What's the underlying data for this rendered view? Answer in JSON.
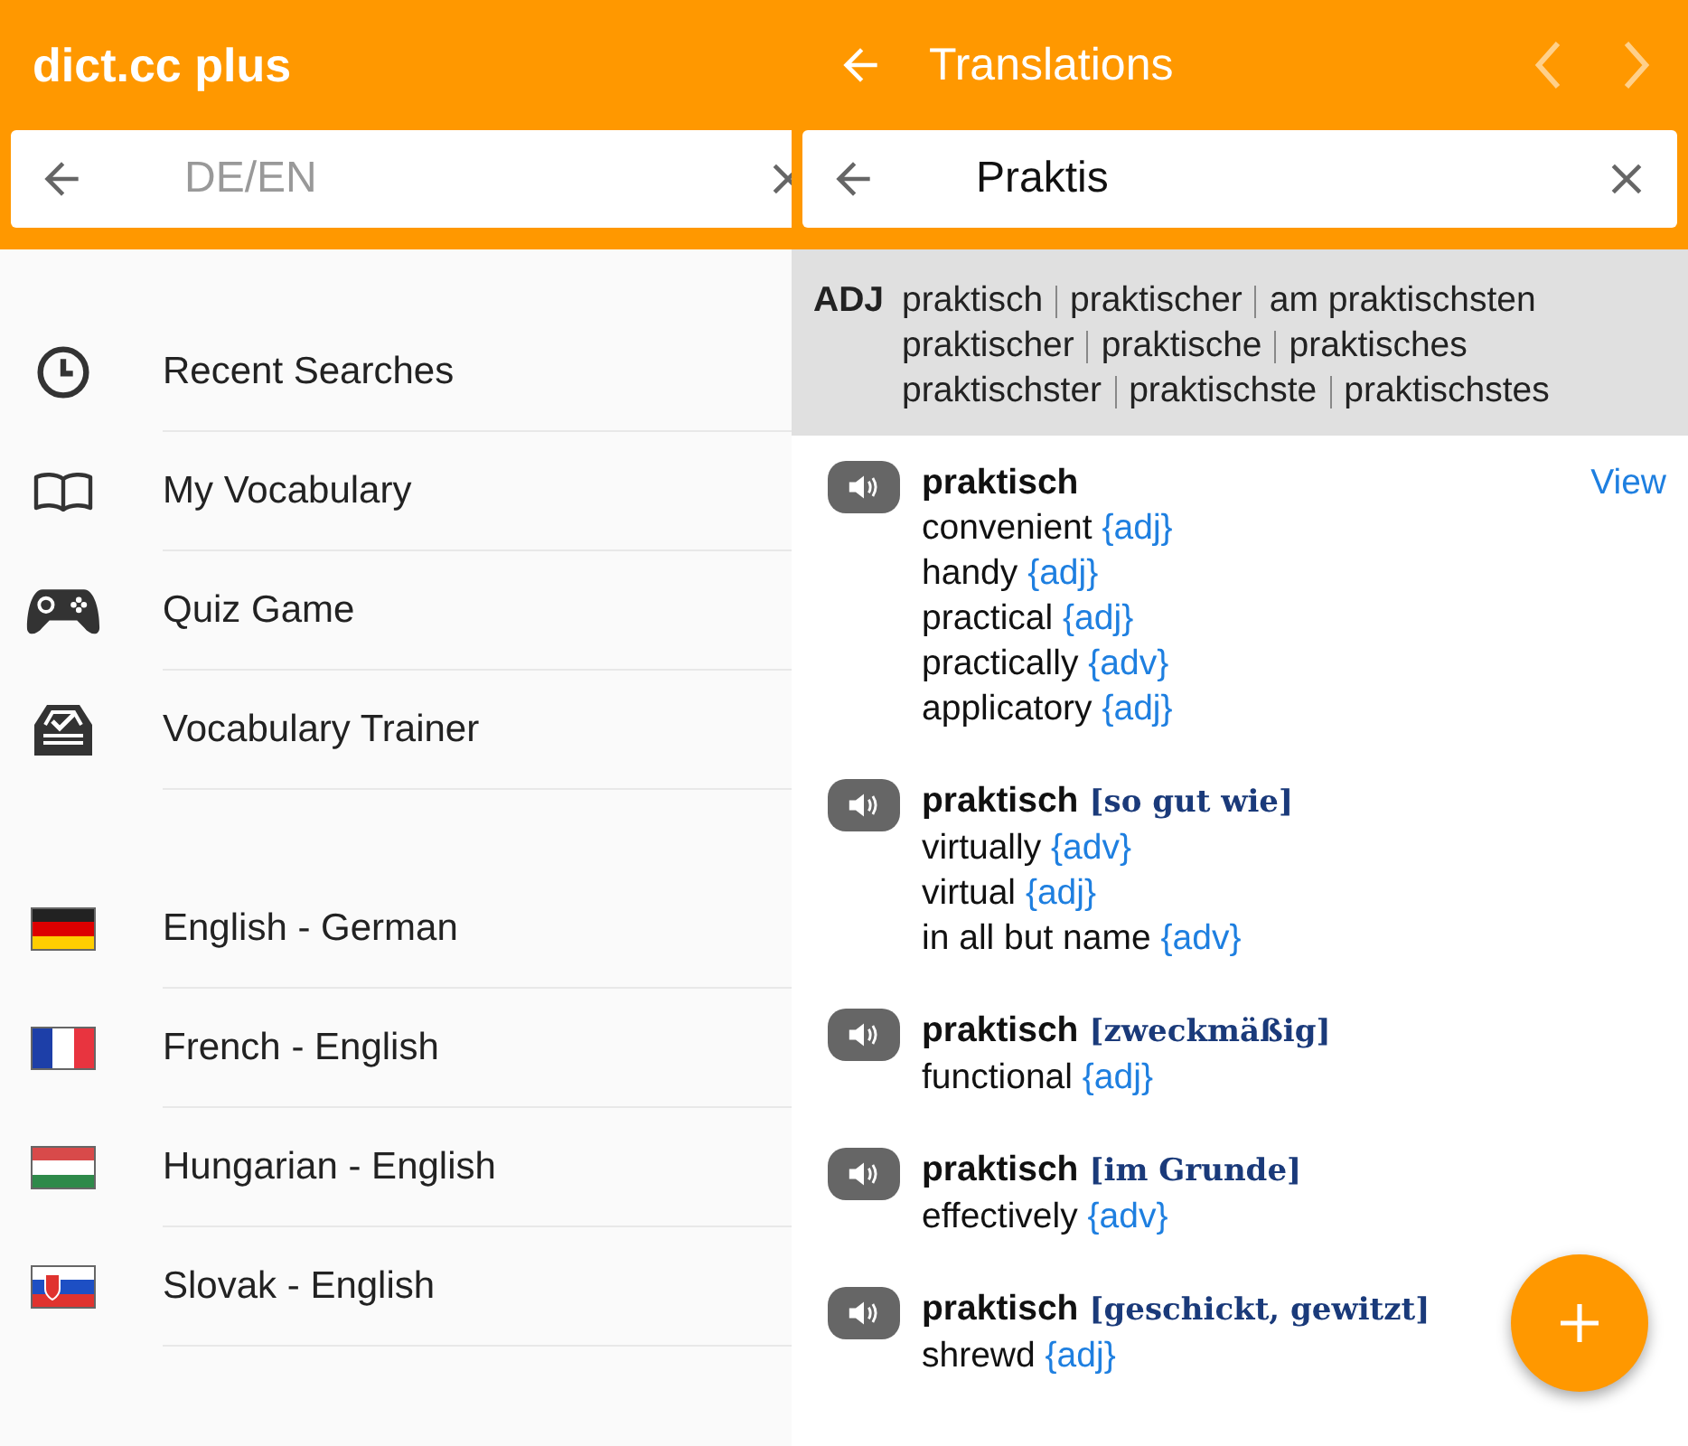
{
  "menu_panel": {
    "app_title": "dict.cc plus",
    "search": {
      "placeholder": "DE/EN"
    },
    "items": [
      {
        "label": "Recent Searches"
      },
      {
        "label": "My Vocabulary"
      },
      {
        "label": "Quiz Game"
      },
      {
        "label": "Vocabulary Trainer"
      }
    ],
    "dictionaries": [
      {
        "label": "English - German"
      },
      {
        "label": "French - English"
      },
      {
        "label": "Hungarian - English"
      },
      {
        "label": "Slovak - English"
      }
    ]
  },
  "translations_panel": {
    "title": "Translations",
    "search": {
      "value": "Praktis"
    },
    "inflection": {
      "label": "ADJ",
      "rows": [
        [
          "praktisch",
          "praktischer",
          "am praktischsten"
        ],
        [
          "praktischer",
          "praktische",
          "praktisches"
        ],
        [
          "praktischster",
          "praktischste",
          "praktischstes"
        ]
      ]
    },
    "entries": [
      {
        "headword": "praktisch",
        "link": "View",
        "translations": [
          {
            "text": "convenient",
            "tag": "{adj}"
          },
          {
            "text": "handy",
            "tag": "{adj}"
          },
          {
            "text": "practical",
            "tag": "{adj}"
          },
          {
            "text": "practically",
            "tag": "{adv}"
          },
          {
            "text": "applicatory",
            "tag": "{adj}"
          }
        ]
      },
      {
        "headword": "praktisch",
        "note": "[so gut wie]",
        "translations": [
          {
            "text": "virtually",
            "tag": "{adv}"
          },
          {
            "text": "virtual",
            "tag": "{adj}"
          },
          {
            "text": "in all but name",
            "tag": "{adv}"
          }
        ]
      },
      {
        "headword": "praktisch",
        "note": "[zweckmäßig]",
        "translations": [
          {
            "text": "functional",
            "tag": "{adj}"
          }
        ]
      },
      {
        "headword": "praktisch",
        "note": "[im Grunde]",
        "translations": [
          {
            "text": "effectively",
            "tag": "{adv}"
          }
        ]
      },
      {
        "headword": "praktisch",
        "note": "[geschickt, gewitzt]",
        "translations": [
          {
            "text": "shrewd",
            "tag": "{adj}"
          }
        ]
      }
    ]
  }
}
